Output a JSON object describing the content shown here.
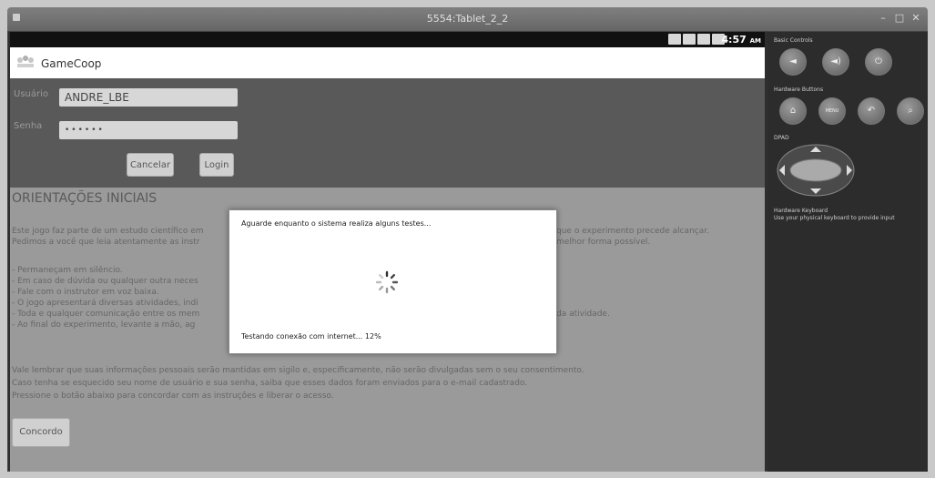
{
  "window": {
    "title": "5554:Tablet_2_2",
    "controls": [
      "–",
      "□",
      "✕"
    ]
  },
  "statusbar": {
    "time": "4:57",
    "ampm": "AM"
  },
  "app": {
    "name": "GameCoop"
  },
  "login": {
    "user_label": "Usuário",
    "user_value": "ANDRE_LBE",
    "pass_label": "Senha",
    "pass_value": "••••••",
    "cancel_label": "Cancelar",
    "login_label": "Login"
  },
  "content": {
    "heading": "ORIENTAÇÕES INICIAIS",
    "intro": [
      "Este jogo faz parte de um estudo científico em",
      "Pedimos a você que leia atentamente as instr"
    ],
    "intro_tail": [
      "que o experimento precede alcançar.",
      "melhor forma possível."
    ],
    "bullets": [
      "- Permaneçam em silêncio.",
      "- Em caso de dúvida ou qualquer outra neces",
      "- Fale com o instrutor em voz baixa.",
      "- O jogo apresentará diversas atividades, indi",
      "- Toda e qualquer comunicação entre os mem",
      "- Ao final do experimento, levante a mão, ag"
    ],
    "bullet_tail": "da atividade.",
    "closing": [
      "Vale lembrar que suas informações pessoais serão mantidas em sigilo e, especificamente, não serão divulgadas sem o seu consentimento.",
      "Caso tenha se esquecido seu nome de usuário e sua senha, saiba que esses dados foram enviados para o e-mail cadastrado.",
      "Pressione o botão abaixo para concordar com as instruções e liberar o acesso."
    ],
    "agree_label": "Concordo"
  },
  "dialog": {
    "message": "Aguarde enquanto o sistema realiza alguns testes...",
    "status": "Testando conexão com internet... 12%",
    "progress_percent": 12
  },
  "panel": {
    "basic_controls": "Basic Controls",
    "hardware_buttons": "Hardware Buttons",
    "dpad": "DPAD",
    "keyboard_title": "Hardware Keyboard",
    "keyboard_desc": "Use your physical keyboard to provide input",
    "menu_label": "MENU"
  }
}
